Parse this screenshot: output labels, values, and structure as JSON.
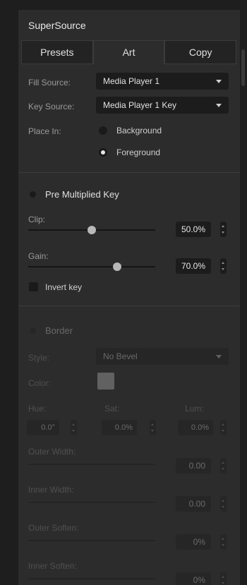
{
  "title": "SuperSource",
  "tabs": [
    "Presets",
    "Art",
    "Copy"
  ],
  "fill_source": {
    "label": "Fill Source:",
    "value": "Media Player 1"
  },
  "key_source": {
    "label": "Key Source:",
    "value": "Media Player 1 Key"
  },
  "place_in": {
    "label": "Place In:",
    "options": [
      "Background",
      "Foreground"
    ],
    "selected": "Foreground"
  },
  "pre_multiplied_key": {
    "label": "Pre Multiplied Key",
    "enabled": false,
    "clip": {
      "label": "Clip:",
      "value": "50.0%",
      "level": 0.5
    },
    "gain": {
      "label": "Gain:",
      "value": "70.0%",
      "level": 0.7
    },
    "invert_key": {
      "label": "Invert key",
      "checked": false
    }
  },
  "border": {
    "label": "Border",
    "enabled": false,
    "style": {
      "label": "Style:",
      "value": "No Bevel"
    },
    "color": {
      "label": "Color:",
      "swatch": "#d2d2d2"
    },
    "hue": {
      "label": "Hue:",
      "value": "0.0°"
    },
    "sat": {
      "label": "Sat:",
      "value": "0.0%"
    },
    "lum": {
      "label": "Lum:",
      "value": "0.0%"
    },
    "outer_width": {
      "label": "Outer Width:",
      "value": "0.00"
    },
    "inner_width": {
      "label": "Inner Width:",
      "value": "0.00"
    },
    "outer_soften": {
      "label": "Outer Soften:",
      "value": "0%"
    },
    "inner_soften": {
      "label": "Inner Soften:",
      "value": "0%"
    }
  }
}
